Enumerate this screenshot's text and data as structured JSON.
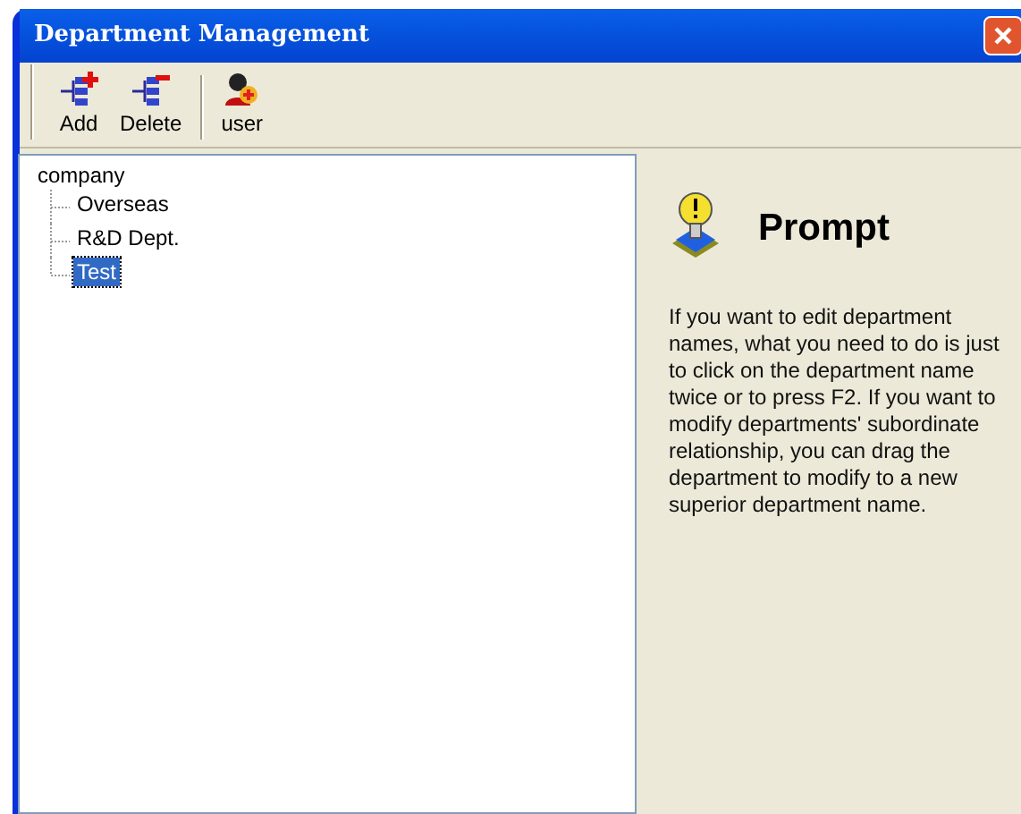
{
  "window": {
    "title": "Department Management"
  },
  "toolbar": [
    {
      "label": "Add",
      "kind": "add"
    },
    {
      "label": "Delete",
      "kind": "delete"
    },
    {
      "label": "user",
      "kind": "user"
    }
  ],
  "tree": {
    "label": "company",
    "selected": false,
    "children": [
      {
        "label": "Overseas",
        "selected": false
      },
      {
        "label": "R&D Dept.",
        "selected": false
      },
      {
        "label": "Test",
        "selected": true
      }
    ]
  },
  "prompt": {
    "title": "Prompt",
    "text": "If you want to edit department names, what you need to do is just to click on the department name twice or to press F2. If you want to modify departments' subordinate relationship, you can drag the department to modify to a new superior department name."
  }
}
